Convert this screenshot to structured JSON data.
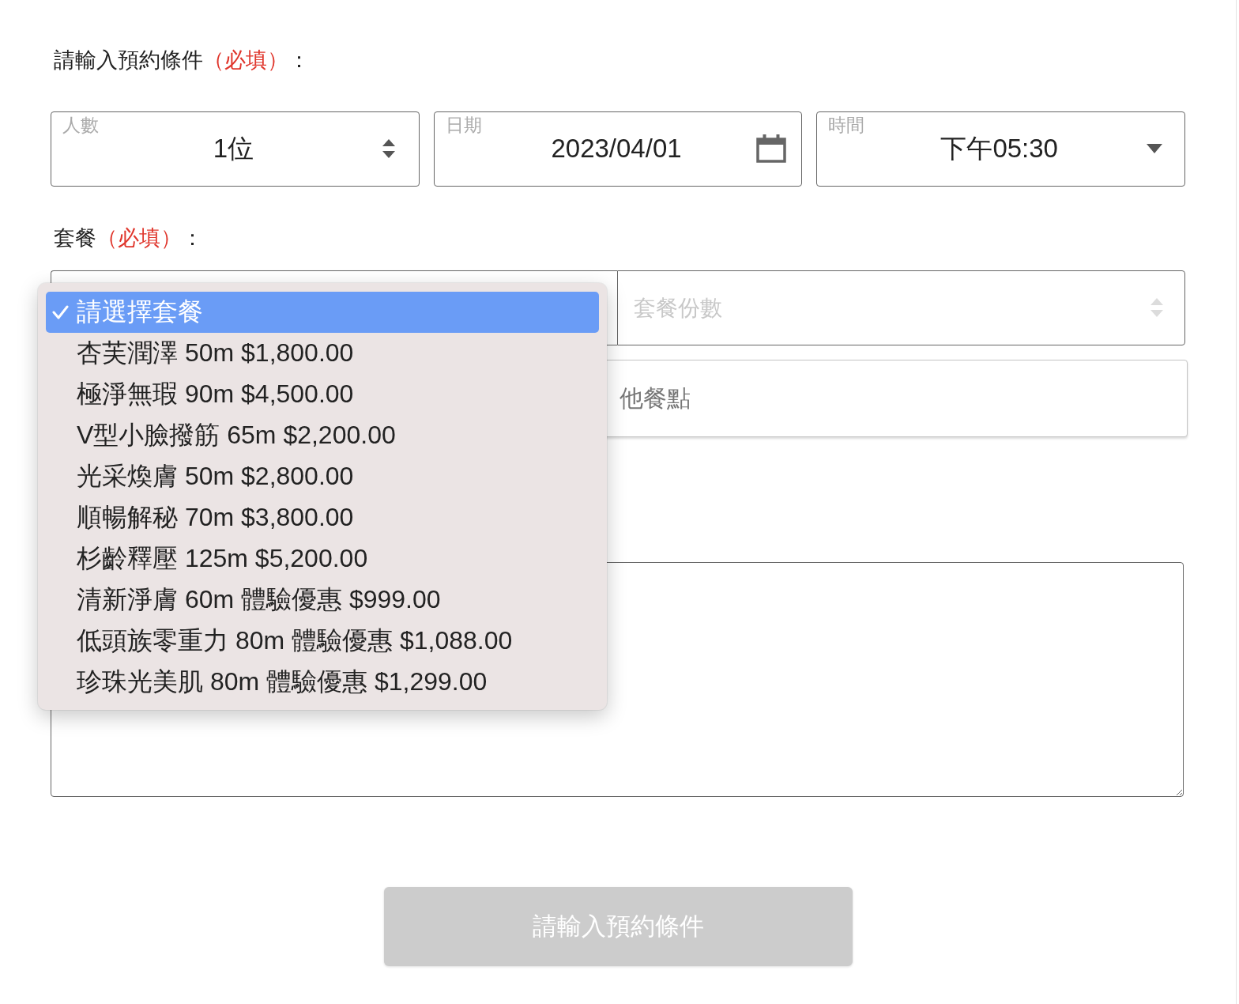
{
  "booking_section": {
    "label": "請輸入預約條件",
    "required": "（必填）",
    "suffix": "："
  },
  "booking_fields": [
    {
      "kind": "stepper",
      "label": "人數",
      "value": "1位"
    },
    {
      "kind": "date",
      "label": "日期",
      "value": "2023/04/01"
    },
    {
      "kind": "select",
      "label": "時間",
      "value": "下午05:30"
    }
  ],
  "package_section": {
    "label": "套餐",
    "required": "（必填）",
    "suffix": "：",
    "package_select": {
      "expanded": true,
      "options": [
        {
          "label": "請選擇套餐",
          "selected": true
        },
        {
          "label": "杏芙潤澤 50m $1,800.00",
          "selected": false
        },
        {
          "label": "極淨無瑕 90m $4,500.00",
          "selected": false
        },
        {
          "label": "V型小臉撥筋 65m $2,200.00",
          "selected": false
        },
        {
          "label": "光采煥膚 50m $2,800.00",
          "selected": false
        },
        {
          "label": "順暢解秘 70m $3,800.00",
          "selected": false
        },
        {
          "label": "杉齡釋壓 125m $5,200.00",
          "selected": false
        },
        {
          "label": "清新淨膚 60m 體驗優惠 $999.00",
          "selected": false
        },
        {
          "label": "低頭族零重力 80m 體驗優惠 $1,088.00",
          "selected": false
        },
        {
          "label": "珍珠光美肌 80m 體驗優惠 $1,299.00",
          "selected": false
        }
      ]
    },
    "quantity_field": {
      "placeholder": "套餐份數",
      "disabled": true
    },
    "extras_field": {
      "placeholder": "他餐點"
    }
  },
  "submit_button": {
    "label": "請輸入預約條件",
    "disabled": true
  }
}
